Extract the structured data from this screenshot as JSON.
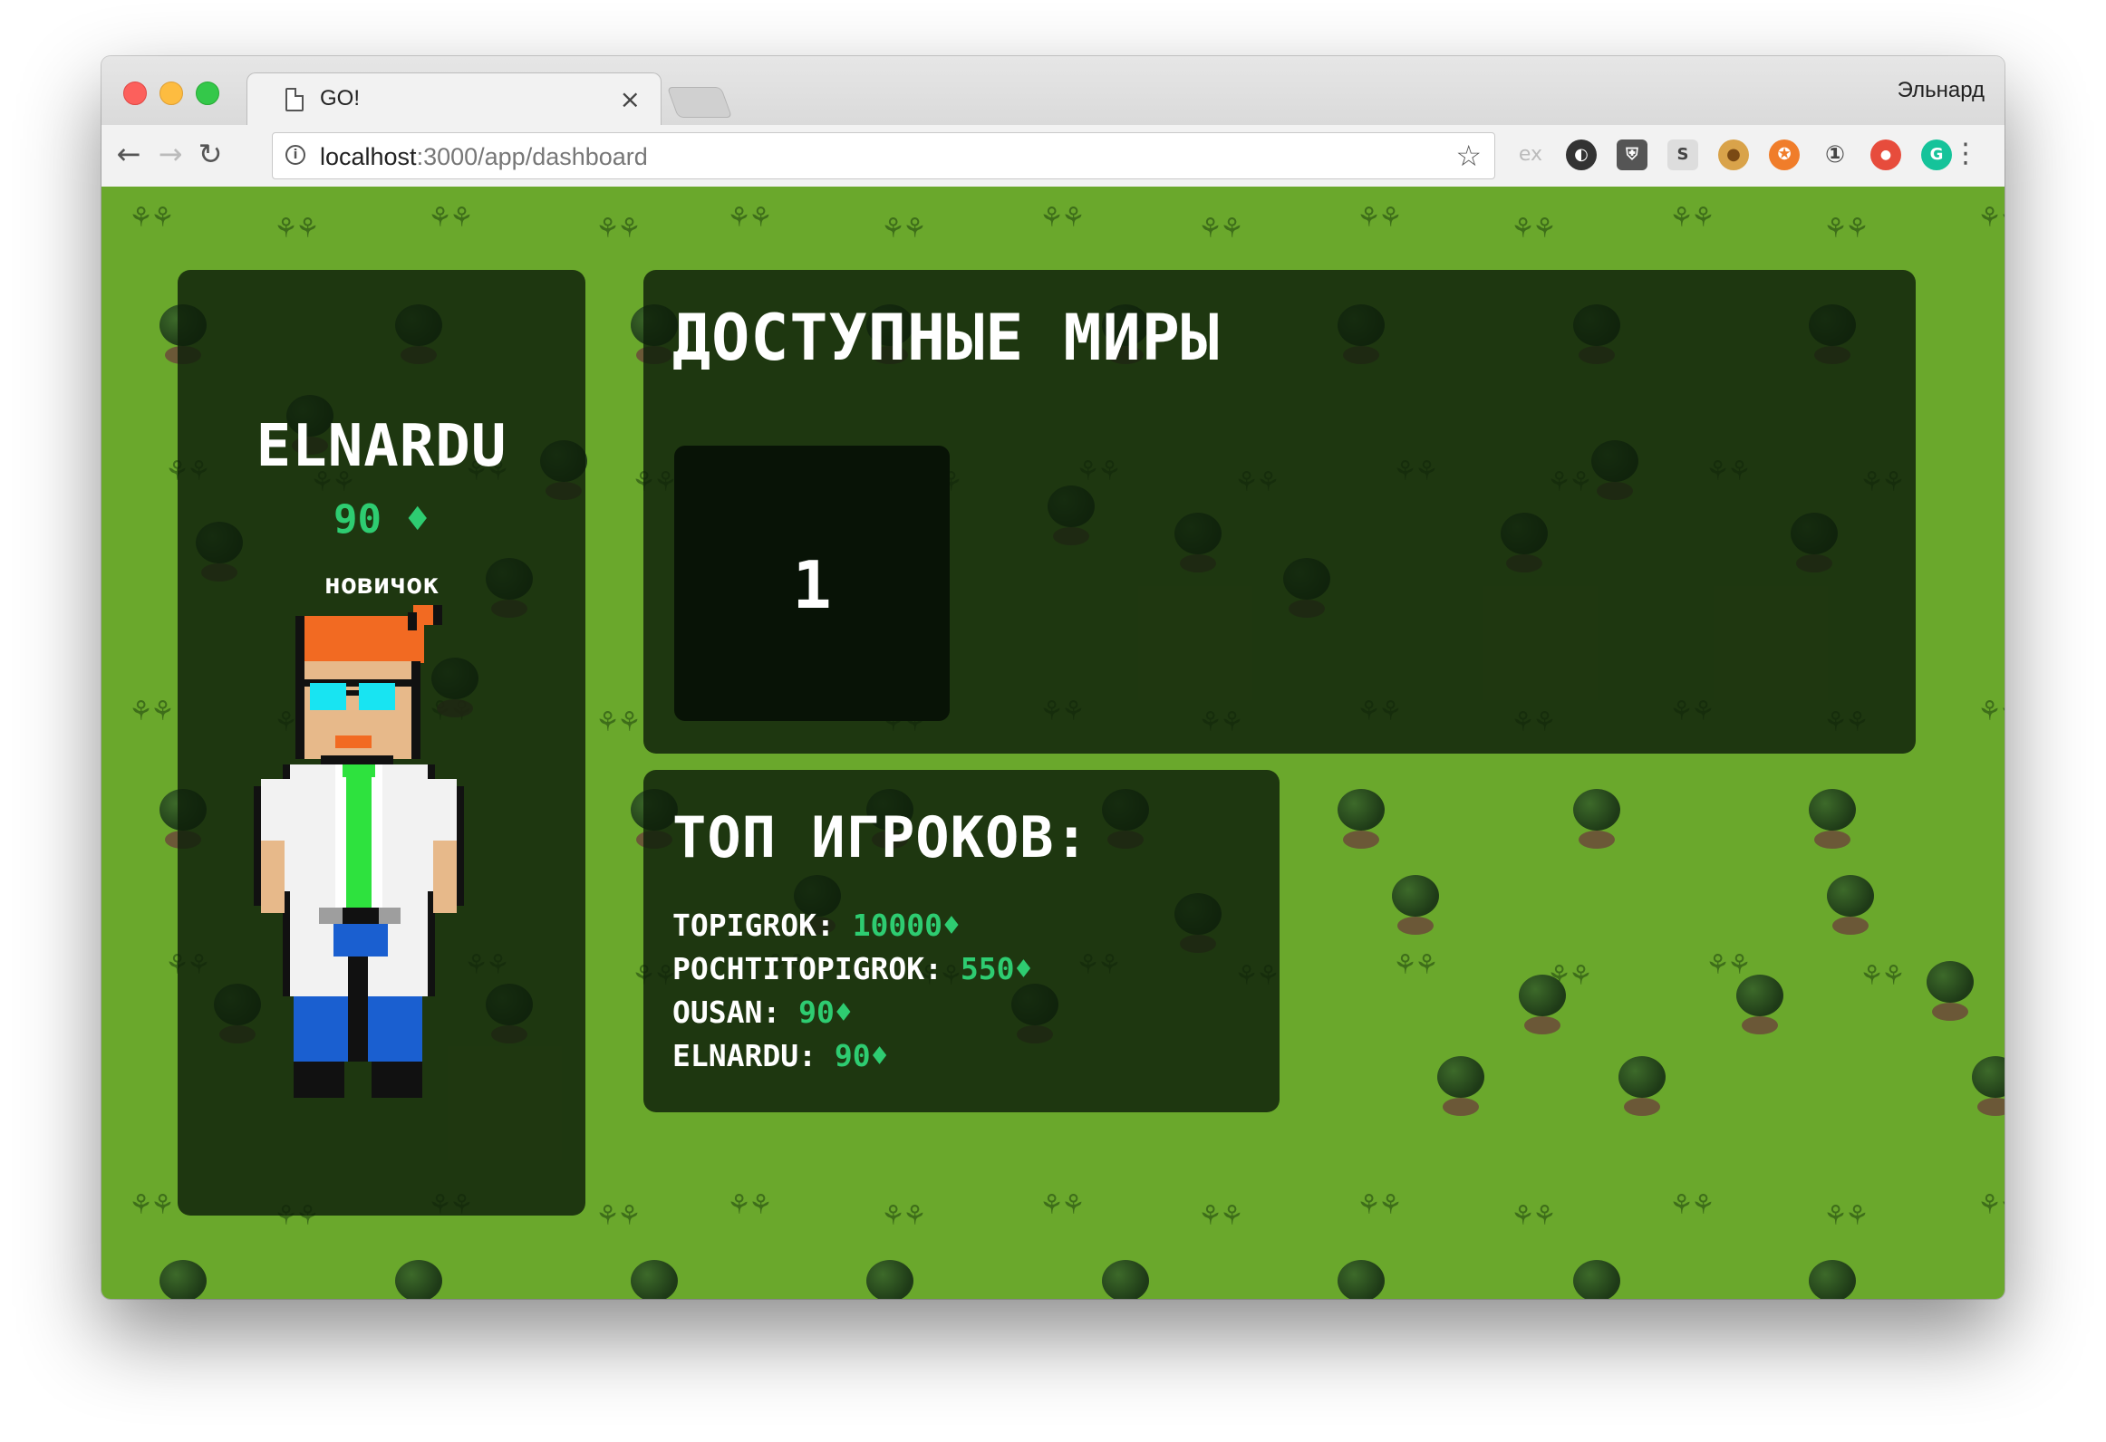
{
  "browser": {
    "tab_title": "GO!",
    "tab_close": "×",
    "profile_name": "Эльнард",
    "url_host": "localhost",
    "url_path": ":3000/app/dashboard",
    "back_glyph": "←",
    "forward_glyph": "→",
    "reload_glyph": "↻",
    "info_glyph": "i",
    "star_glyph": "☆",
    "menu_glyph": "⋮",
    "extensions": [
      {
        "name": "ex-extension-icon",
        "label": "ex"
      },
      {
        "name": "speed-extension-icon",
        "label": "◐"
      },
      {
        "name": "shield-extension-icon",
        "label": "⛨"
      },
      {
        "name": "s-extension-icon",
        "label": "S"
      },
      {
        "name": "cookie-extension-icon",
        "label": "●"
      },
      {
        "name": "orange-extension-icon",
        "label": "✪"
      },
      {
        "name": "password-extension-icon",
        "label": "①"
      },
      {
        "name": "record-extension-icon",
        "label": "●"
      },
      {
        "name": "grammarly-extension-icon",
        "label": "G"
      }
    ]
  },
  "profile": {
    "username": "ELNARDU",
    "gems": "90",
    "gem_glyph": "♦",
    "rank": "новичок"
  },
  "worlds": {
    "title": "ДОСТУПНЫЕ МИРЫ",
    "items": [
      "1"
    ]
  },
  "leaderboard": {
    "title": "ТОП ИГРОКОВ:",
    "rows": [
      {
        "name": "TOPIGROK:",
        "score": "10000"
      },
      {
        "name": "POCHTITOPIGROK:",
        "score": "550"
      },
      {
        "name": "OUSAN:",
        "score": "90"
      },
      {
        "name": "ELNARDU:",
        "score": "90"
      }
    ]
  },
  "colors": {
    "grass": "#6aa82c",
    "panel": "#0e1e0a",
    "gem": "#2ecc71"
  }
}
